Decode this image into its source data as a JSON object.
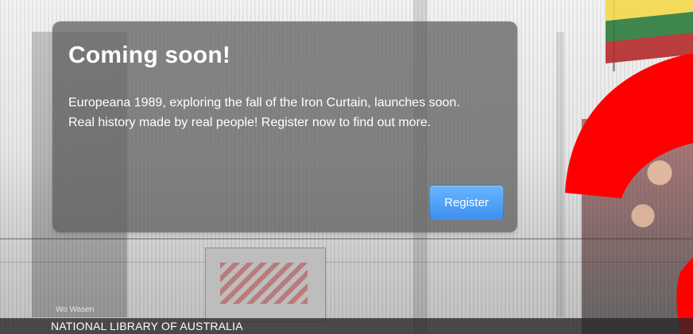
{
  "card": {
    "title": "Coming soon!",
    "body": "Europeana 1989, exploring the fall of the Iron Curtain, launches soon. Real history made by real people! Register now to find out more.",
    "register_label": "Register"
  },
  "footer": {
    "credit": "Wo Wasen",
    "label": "NATIONAL LIBRARY OF AUSTRALIA"
  },
  "colors": {
    "card_overlay": "#5a5a5a",
    "button_blue": "#3f8ff0",
    "logo_red": "#ff0000"
  }
}
